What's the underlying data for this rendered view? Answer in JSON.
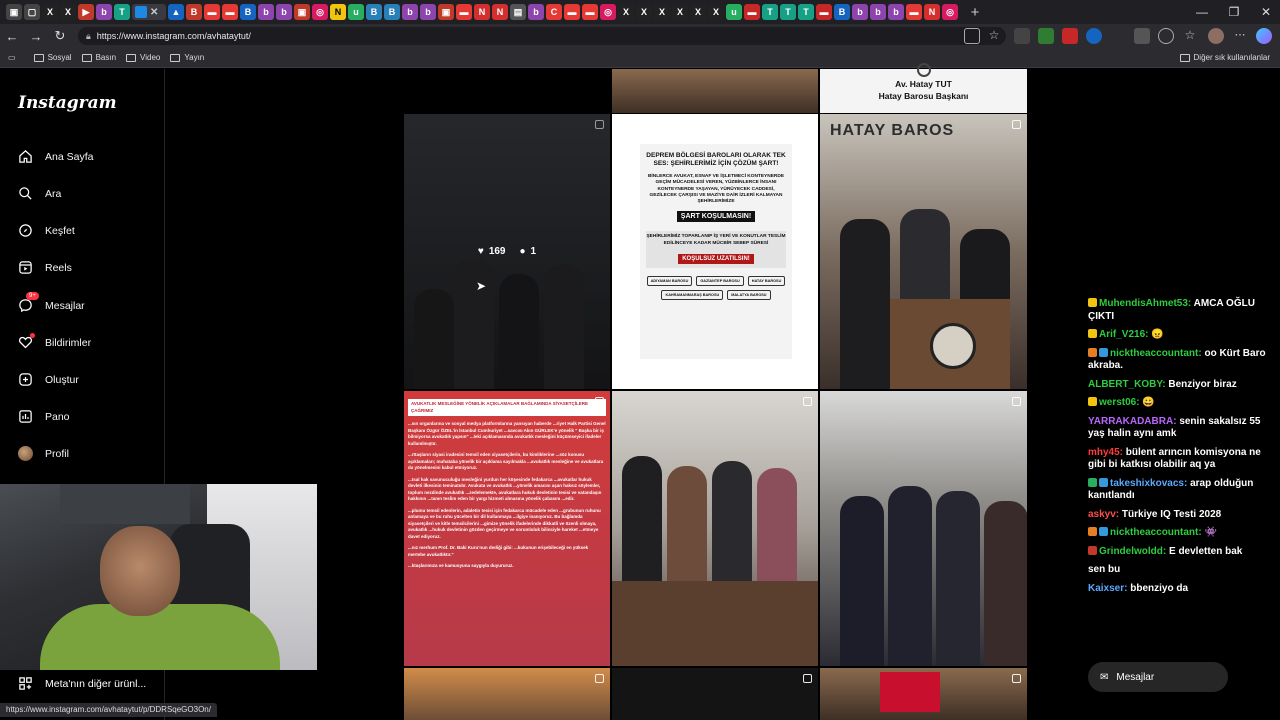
{
  "browser": {
    "url": "https://www.instagram.com/avhataytut/",
    "status_url": "https://www.instagram.com/avhataytut/p/DDRSqeGO3On/",
    "bookmarks": [
      "Sosyal",
      "Basın",
      "Video",
      "Yayın"
    ],
    "other_bookmarks": "Diğer sık kullanılanlar"
  },
  "sidebar": {
    "logo": "Instagram",
    "items": [
      {
        "label": "Ana Sayfa",
        "icon": "home-icon"
      },
      {
        "label": "Ara",
        "icon": "search-icon"
      },
      {
        "label": "Keşfet",
        "icon": "compass-icon"
      },
      {
        "label": "Reels",
        "icon": "reels-icon"
      },
      {
        "label": "Mesajlar",
        "icon": "messenger-icon",
        "badge": "9+"
      },
      {
        "label": "Bildirimler",
        "icon": "heart-icon"
      },
      {
        "label": "Oluştur",
        "icon": "plus-square-icon"
      },
      {
        "label": "Pano",
        "icon": "dashboard-icon"
      },
      {
        "label": "Profil",
        "icon": "avatar"
      }
    ],
    "more": "Meta'nın diğer ürünl..."
  },
  "posts": {
    "hatay_name": "Av. Hatay TUT",
    "hatay_title": "Hatay Barosu Başkanı",
    "hover_likes": "169",
    "hover_comments": "1",
    "hatay_sign": "HATAY BAROS",
    "poster": {
      "heading": "DEPREM BÖLGESİ BAROLARI OLARAK TEK SES: ŞEHİRLERİMİZ İÇİN ÇÖZÜM ŞART!",
      "body": "BİNLERCE AVUKAT, ESNAF VE İŞLETMECİ KONTEYNERDE GEÇİM MÜCADELESİ VEREN, YÜZBİNLERCE İNSANI KONTEYNERDE YAŞAYAN, YÜRÜYECEK CADDESİ, GEZİLECEK ÇARŞISI VE MAZİYE DAİR İZLERİ KALMAYAN ŞEHİRLERİMİZE",
      "black_banner": "ŞART KOŞULMASIN!",
      "body2": "ŞEHİRLERİMİZ TOPARLANIP İŞ YERİ VE KONUTLAR TESLİM EDİLİNCEYE KADAR MÜCBİR SEBEP SÜRESİ",
      "red_banner": "KOŞULSUZ UZATILSIN!",
      "bars": [
        "ADIYAMAN BAROSU",
        "GAZİANTEP BAROSU",
        "HATAY BAROSU",
        "KAHRAMANMARAŞ BAROSU",
        "MALATYA BAROSU"
      ]
    },
    "red_post": {
      "top": "AVUKATLIK MESLEĞİNE YÖNELİK AÇIKLAMALAR BAĞLAMINDA SİYASETÇİLERE ÇAĞRIMIZ",
      "p1": "...sın organlarına ve sosyal medya platformlarına yansıyan haberde ...riyet Halk Partisi Genel Başkanı Özgür ÖZEL'in İstanbul Cumhuriyet ...savcısı Akın GÜRLEK'e yönelik \" Başka bir iş bilmiyorsa avukatlık yapsın\" ...leki açıklamasında avukatlık mesleğini küçümseyici ifadeler kullanılmıştır.",
      "p2": "...rttaşların siyasi iradesini temsil eden siyasetçilerin, bu kimliklerine ...söz konusu açıklamaları; muhataba yönelik bir açıklama sayılmakla ...avukatlık mesleğine ve avukatlara da yönelmesini kabul etmiyoruz.",
      "p3": "...tsal hak savunuculuğu mesleğini yurdun her köşesinde fedakarca ...avukatlar hukuk devleti ilkesinin teminatıdır. Avukata ve avukatlık ...yönelik amacını aşan haksız söylemler, toplum nezdinde avukatlık ...zedelemekte, avukatlara hukuk devletinin tesisi ve vatandaşın hakkının ...tanın teslim eden bir yargı hizmeti almasına yönelik çabasını ...edir.",
      "p4": "...plumu temsil edenlerin, adaletin tesisi için fedakarca mücadele eden ...grubunun ruhunu anlamaya ve bu ruhu yücelten bir dil kullanmaya ...ilgiye inanıyoruz. Bu bağlamda siyasetçileri ve kitle temsilcilerini ...gimize yönelik ifadelerinde dikkatli ve özenli olmaya, avukatlık ...hukuk devletinin gözden geçirmeye ve sorumluluk bilinciyle hareket ...etmeye davet ediyoruz.",
      "p5": "...nız merhum Prof. Dr. Baki Kuru'nun dediği gibi: ...kukunun erişebileceği en yüksek mertebe avukatlıktır.\"",
      "p6": "...ktaşlarımıza ve kamuoyuna saygıyla duyururuz."
    }
  },
  "chat": [
    {
      "user": "MuhendisAhmet53:",
      "text": "AMCA OĞLU ÇIKTI",
      "color": "#2ecc40"
    },
    {
      "user": "Arif_V216:",
      "text": "",
      "color": "#2ecc40"
    },
    {
      "user": "nicktheaccountant:",
      "text": "oo Kürt Baro akraba.",
      "color": "#2ecc40"
    },
    {
      "user": "ALBERT_KOBY:",
      "text": "Benziyor biraz",
      "color": "#2ecc40"
    },
    {
      "user": "werst06:",
      "text": "",
      "color": "#2ecc40"
    },
    {
      "user": "YARRAKADABRA:",
      "text": "senin sakalsız 55 yaş halin aynı amk",
      "color": "#b966ff"
    },
    {
      "user": "mhy45:",
      "text": "bülent arıncın komisyona ne gibi bi katkısı olabilir aq ya",
      "color": "#ff3b3b"
    },
    {
      "user": "takeshixkovacs:",
      "text": "arap olduğun kanıtlandı",
      "color": "#5aa9ff"
    },
    {
      "user": "askyv:",
      "text": "Türkiye IQ Testi 2028",
      "color": "#ff4d4d"
    },
    {
      "user": "nicktheaccountant:",
      "text": "",
      "color": "#2ecc40"
    },
    {
      "user": "Grindelwoldd:",
      "text": "E devletten bak",
      "color": "#2ecc40"
    },
    {
      "user": "",
      "text": "sen bu",
      "color": "#ff4d4d"
    },
    {
      "user": "Kaixser:",
      "text": "bbenziyo da",
      "color": "#5aa9ff"
    }
  ],
  "messages_popup": "Mesajlar"
}
